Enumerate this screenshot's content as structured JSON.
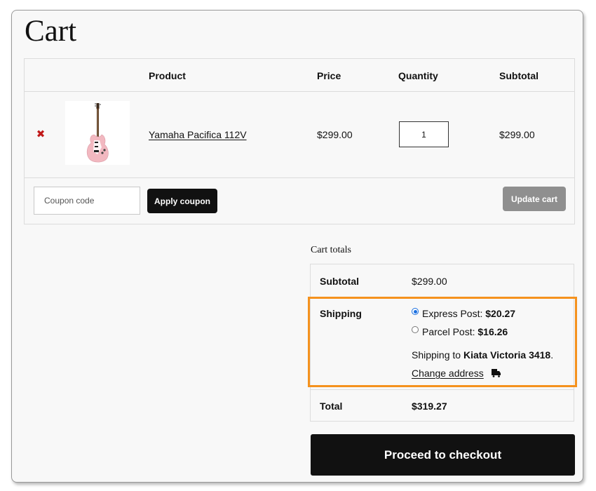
{
  "page": {
    "title": "Cart"
  },
  "table": {
    "headers": {
      "product": "Product",
      "price": "Price",
      "quantity": "Quantity",
      "subtotal": "Subtotal"
    },
    "items": [
      {
        "name": "Yamaha Pacifica 112V",
        "price": "$299.00",
        "quantity": "1",
        "subtotal": "$299.00"
      }
    ]
  },
  "actions": {
    "coupon_placeholder": "Coupon code",
    "apply_coupon": "Apply coupon",
    "update_cart": "Update cart"
  },
  "totals": {
    "title": "Cart totals",
    "subtotal_label": "Subtotal",
    "subtotal_value": "$299.00",
    "shipping_label": "Shipping",
    "options": [
      {
        "label": "Express Post:",
        "price": "$20.27",
        "selected": true
      },
      {
        "label": "Parcel Post:",
        "price": "$16.26",
        "selected": false
      }
    ],
    "shipping_to_prefix": "Shipping to",
    "shipping_to_location": "Kiata Victoria 3418",
    "shipping_to_suffix": ".",
    "change_address": "Change address",
    "total_label": "Total",
    "total_value": "$319.27"
  },
  "checkout": {
    "label": "Proceed to checkout"
  },
  "colors": {
    "highlight": "#f5921e",
    "remove": "#c11a1a",
    "radio_selected": "#1a6fe0",
    "guitar_body": "#f2b8c0"
  },
  "icons": {
    "remove": "x-mark-icon",
    "change_address": "truck-icon"
  }
}
